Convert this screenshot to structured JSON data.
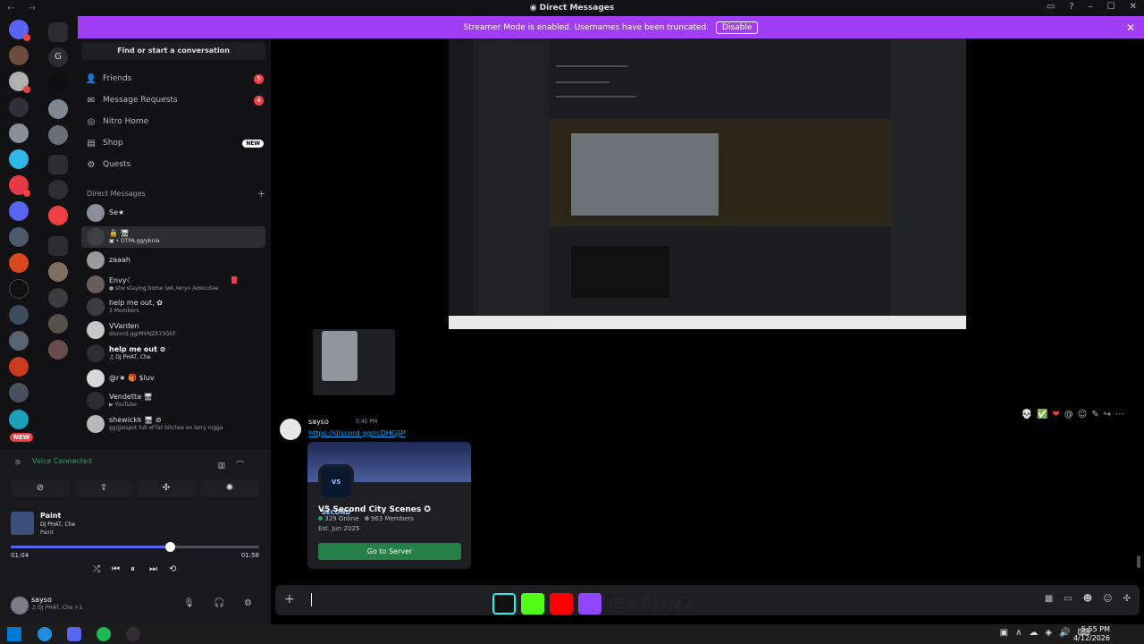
{
  "titlebar": {
    "title": "Direct Messages",
    "nav": "← →",
    "controls": [
      "▭",
      "?",
      "–",
      "☐",
      "✕"
    ]
  },
  "banner": {
    "text": "Streamer Mode is enabled. Usernames have been truncated.",
    "button": "Disable",
    "close": "✕"
  },
  "guilds": {
    "letter": "G",
    "new_label": "NEW"
  },
  "dm_panel": {
    "search_placeholder": "Find or start a conversation",
    "nav": [
      {
        "label": "Friends",
        "badge": "5",
        "icon": "friends-icon"
      },
      {
        "label": "Message Requests",
        "badge": "4",
        "icon": "mail-icon"
      },
      {
        "label": "Nitro Home",
        "badge": "",
        "icon": "nitro-icon"
      },
      {
        "label": "Shop",
        "badge": "NEW",
        "icon": "shop-icon"
      },
      {
        "label": "Quests",
        "badge": "",
        "icon": "quests-icon"
      }
    ],
    "dm_header": "Direct Messages",
    "dm_add": "+",
    "dms": [
      {
        "name": "Se★",
        "sub": ""
      },
      {
        "name": "🔒 🖥",
        "sub": "▣ • OTPA.gg/ybnla"
      },
      {
        "name": "zaaah",
        "sub": ""
      },
      {
        "name": "Envy☾",
        "sub": "● she staying home lwk /wryn /executee"
      },
      {
        "name": "help me out, ✿",
        "sub": "3 Members"
      },
      {
        "name": "VVarden",
        "sub": "discord.gg/MVNZR73GhF"
      },
      {
        "name": "help me out ⊘",
        "sub": "♫ DJ PHAT, Che"
      },
      {
        "name": "@r★ 🎁 $luv",
        "sub": ""
      },
      {
        "name": "Vendetta 🖥",
        "sub": "▶ YouTube"
      },
      {
        "name": "shewickk 🖥 ⊘",
        "sub": "gg/jjeispot full of fat bitches on larry nigga"
      }
    ]
  },
  "voice": {
    "status": "Voice Connected",
    "track_title": "Paint",
    "track_artist": "DJ PHAT, Che",
    "track_album": "Paint",
    "time_current": "01:04",
    "time_total": "01:58",
    "progress": 0.64,
    "buttons": [
      "⊘",
      "⇪",
      "✣",
      "✺"
    ],
    "controls": [
      "⤮",
      "⏮",
      "⏸",
      "⏭",
      "⟲"
    ]
  },
  "user": {
    "name": "sayso",
    "status": "♫ DJ PHAT, Che +1",
    "icons": [
      "🎙",
      "🎧",
      "⚙"
    ]
  },
  "message": {
    "author": "sayso",
    "time": "5:45 PM",
    "link": "https://discord.gg/rcDHGJjP",
    "actions": [
      "💀",
      "✅",
      "❤",
      "@",
      "☺",
      "✎",
      "↪",
      "⋯"
    ]
  },
  "invite": {
    "icon_text": "V5 SECOND",
    "server_name": "V5 Second City Scenes ✪",
    "online": "329 Online",
    "members": "963 Members",
    "established": "Est. Jun 2025",
    "button": "Go to Server"
  },
  "composer": {
    "plus": "+",
    "icons": [
      "▦",
      "▭",
      "☻",
      "☺",
      "✣"
    ]
  },
  "overlay": {
    "handle": "@KFUN2"
  },
  "taskbar": {
    "time": "5:55 PM",
    "date": "4/12/2026",
    "tray": [
      "▣",
      "∧",
      "☁",
      "◈",
      "🔊",
      "⌨"
    ]
  }
}
